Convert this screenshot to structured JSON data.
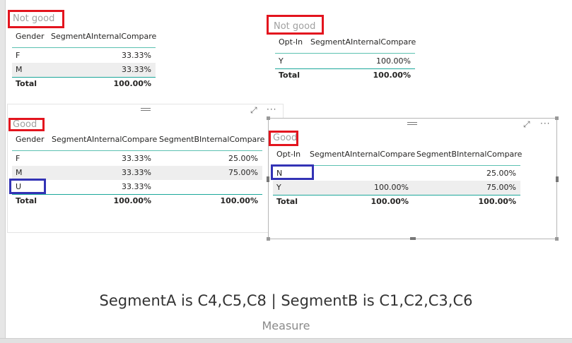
{
  "labels": {
    "not_good": "Not good",
    "good": "Good"
  },
  "table1": {
    "headers": [
      "Gender",
      "SegmentAInternalCompare"
    ],
    "rows": [
      [
        "F",
        "33.33%"
      ],
      [
        "M",
        "33.33%"
      ]
    ],
    "total": [
      "Total",
      "100.00%"
    ]
  },
  "table2": {
    "headers": [
      "Opt-In",
      "SegmentAInternalCompare"
    ],
    "rows": [
      [
        "Y",
        "100.00%"
      ]
    ],
    "total": [
      "Total",
      "100.00%"
    ]
  },
  "table3": {
    "headers": [
      "Gender",
      "SegmentAInternalCompare",
      "SegmentBInternalCompare"
    ],
    "rows": [
      [
        "F",
        "33.33%",
        "25.00%"
      ],
      [
        "M",
        "33.33%",
        "75.00%"
      ],
      [
        "U",
        "33.33%",
        ""
      ]
    ],
    "total": [
      "Total",
      "100.00%",
      "100.00%"
    ]
  },
  "table4": {
    "headers": [
      "Opt-In",
      "SegmentAInternalCompare",
      "SegmentBInternalCompare"
    ],
    "rows": [
      [
        "N",
        "",
        "25.00%"
      ],
      [
        "Y",
        "100.00%",
        "75.00%"
      ]
    ],
    "total": [
      "Total",
      "100.00%",
      "100.00%"
    ]
  },
  "icons": {
    "focus": "focus-mode-icon",
    "more": "more-options-icon",
    "grip": "drag-grip-icon"
  },
  "colors": {
    "annotation_red": "#e3141e",
    "annotation_blue": "#3333b5",
    "table_rule": "#5bc1b1"
  },
  "caption": {
    "text": "SegmentA is C4,C5,C8 | SegmentB is C1,C2,C3,C6",
    "label": "Measure"
  }
}
